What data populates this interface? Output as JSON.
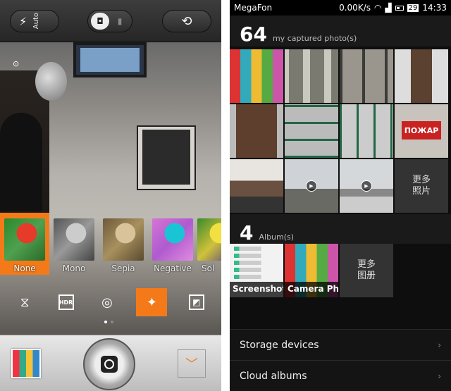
{
  "camera": {
    "flash_mode": "Auto",
    "flash_icon": "flash-icon",
    "mode_toggle": {
      "photo_icon": "camera-icon",
      "video_icon": "video-icon"
    },
    "switch_icon": "switch-camera-icon",
    "effects": [
      {
        "label": "None",
        "selected": true
      },
      {
        "label": "Mono",
        "selected": false
      },
      {
        "label": "Sepia",
        "selected": false
      },
      {
        "label": "Negative",
        "selected": false
      },
      {
        "label": "Sol",
        "selected": false
      }
    ],
    "tools": [
      {
        "icon": "panorama-icon"
      },
      {
        "icon": "hdr-icon",
        "text": "HDR"
      },
      {
        "icon": "timer-icon"
      },
      {
        "icon": "magic-wand-icon",
        "active": true
      },
      {
        "icon": "exposure-icon"
      }
    ],
    "pager": {
      "pages": 2,
      "current": 1
    },
    "expand_icon": "chevron-down-icon",
    "accent": "#f47a19"
  },
  "status": {
    "carrier": "MegaFon",
    "speed": "0.00K/s",
    "battery": "29",
    "time": "14:33"
  },
  "gallery": {
    "photo_count": "64",
    "photo_label": "my captured photo(s)",
    "more_photos": "更多\n照片",
    "album_count": "4",
    "album_label": "Album(s)",
    "albums": [
      {
        "name": "Screenshots"
      },
      {
        "name": "Camera Ph..."
      }
    ],
    "more_albums": "更多\n图册",
    "sign_text": "ПОЖАР",
    "list": [
      {
        "label": "Storage devices"
      },
      {
        "label": "Cloud albums"
      }
    ]
  }
}
